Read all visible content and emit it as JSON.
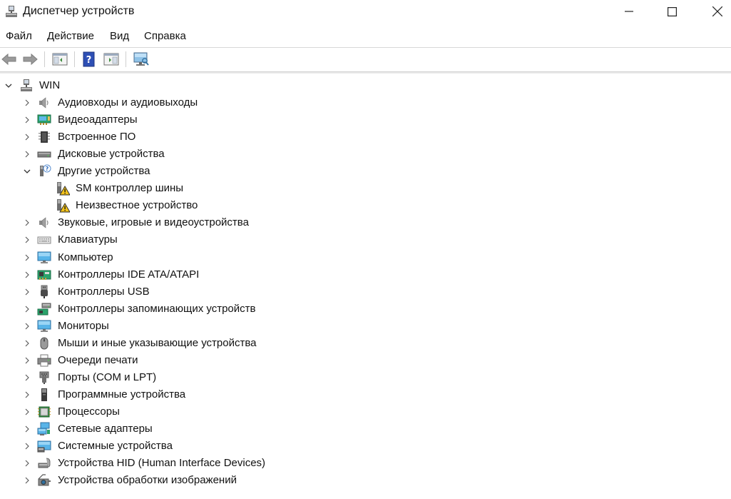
{
  "window": {
    "title": "Диспетчер устройств"
  },
  "menu": [
    {
      "label": "Файл"
    },
    {
      "label": "Действие"
    },
    {
      "label": "Вид"
    },
    {
      "label": "Справка"
    }
  ],
  "toolbar": [
    {
      "name": "back-button",
      "icon": "arrow-left-icon"
    },
    {
      "name": "forward-button",
      "icon": "arrow-right-icon"
    },
    {
      "name": "show-hide-console-tree-button",
      "icon": "console-tree-icon"
    },
    {
      "name": "help-button",
      "icon": "help-icon"
    },
    {
      "name": "action-pane-button",
      "icon": "action-pane-icon"
    },
    {
      "name": "scan-hardware-button",
      "icon": "monitor-scan-icon"
    }
  ],
  "tree": {
    "root": {
      "label": "WIN",
      "icon": "computer-tree-icon",
      "expanded": true
    },
    "items": [
      {
        "label": "Аудиовходы и аудиовыходы",
        "icon": "speaker-icon",
        "expanded": false
      },
      {
        "label": "Видеоадаптеры",
        "icon": "display-adapter-icon",
        "expanded": false
      },
      {
        "label": "Встроенное ПО",
        "icon": "firmware-chip-icon",
        "expanded": false
      },
      {
        "label": "Дисковые устройства",
        "icon": "disk-drive-icon",
        "expanded": false
      },
      {
        "label": "Другие устройства",
        "icon": "unknown-device-icon",
        "expanded": true,
        "children": [
          {
            "label": "SM контроллер шины",
            "icon": "warning-device-icon"
          },
          {
            "label": "Неизвестное устройство",
            "icon": "warning-device-icon"
          }
        ]
      },
      {
        "label": "Звуковые, игровые и видеоустройства",
        "icon": "speaker-icon",
        "expanded": false
      },
      {
        "label": "Клавиатуры",
        "icon": "keyboard-icon",
        "expanded": false
      },
      {
        "label": "Компьютер",
        "icon": "computer-icon",
        "expanded": false
      },
      {
        "label": "Контроллеры IDE ATA/ATAPI",
        "icon": "ide-controller-icon",
        "expanded": false
      },
      {
        "label": "Контроллеры USB",
        "icon": "usb-icon",
        "expanded": false
      },
      {
        "label": "Контроллеры запоминающих устройств",
        "icon": "storage-controller-icon",
        "expanded": false
      },
      {
        "label": "Мониторы",
        "icon": "monitor-icon",
        "expanded": false
      },
      {
        "label": "Мыши и иные указывающие устройства",
        "icon": "mouse-icon",
        "expanded": false
      },
      {
        "label": "Очереди печати",
        "icon": "printer-icon",
        "expanded": false
      },
      {
        "label": "Порты (COM и LPT)",
        "icon": "port-icon",
        "expanded": false
      },
      {
        "label": "Программные устройства",
        "icon": "software-device-icon",
        "expanded": false
      },
      {
        "label": "Процессоры",
        "icon": "processor-icon",
        "expanded": false
      },
      {
        "label": "Сетевые адаптеры",
        "icon": "network-adapter-icon",
        "expanded": false
      },
      {
        "label": "Системные устройства",
        "icon": "system-device-icon",
        "expanded": false
      },
      {
        "label": "Устройства HID (Human Interface Devices)",
        "icon": "hid-icon",
        "expanded": false
      },
      {
        "label": "Устройства обработки изображений",
        "icon": "camera-icon",
        "expanded": false
      }
    ]
  }
}
